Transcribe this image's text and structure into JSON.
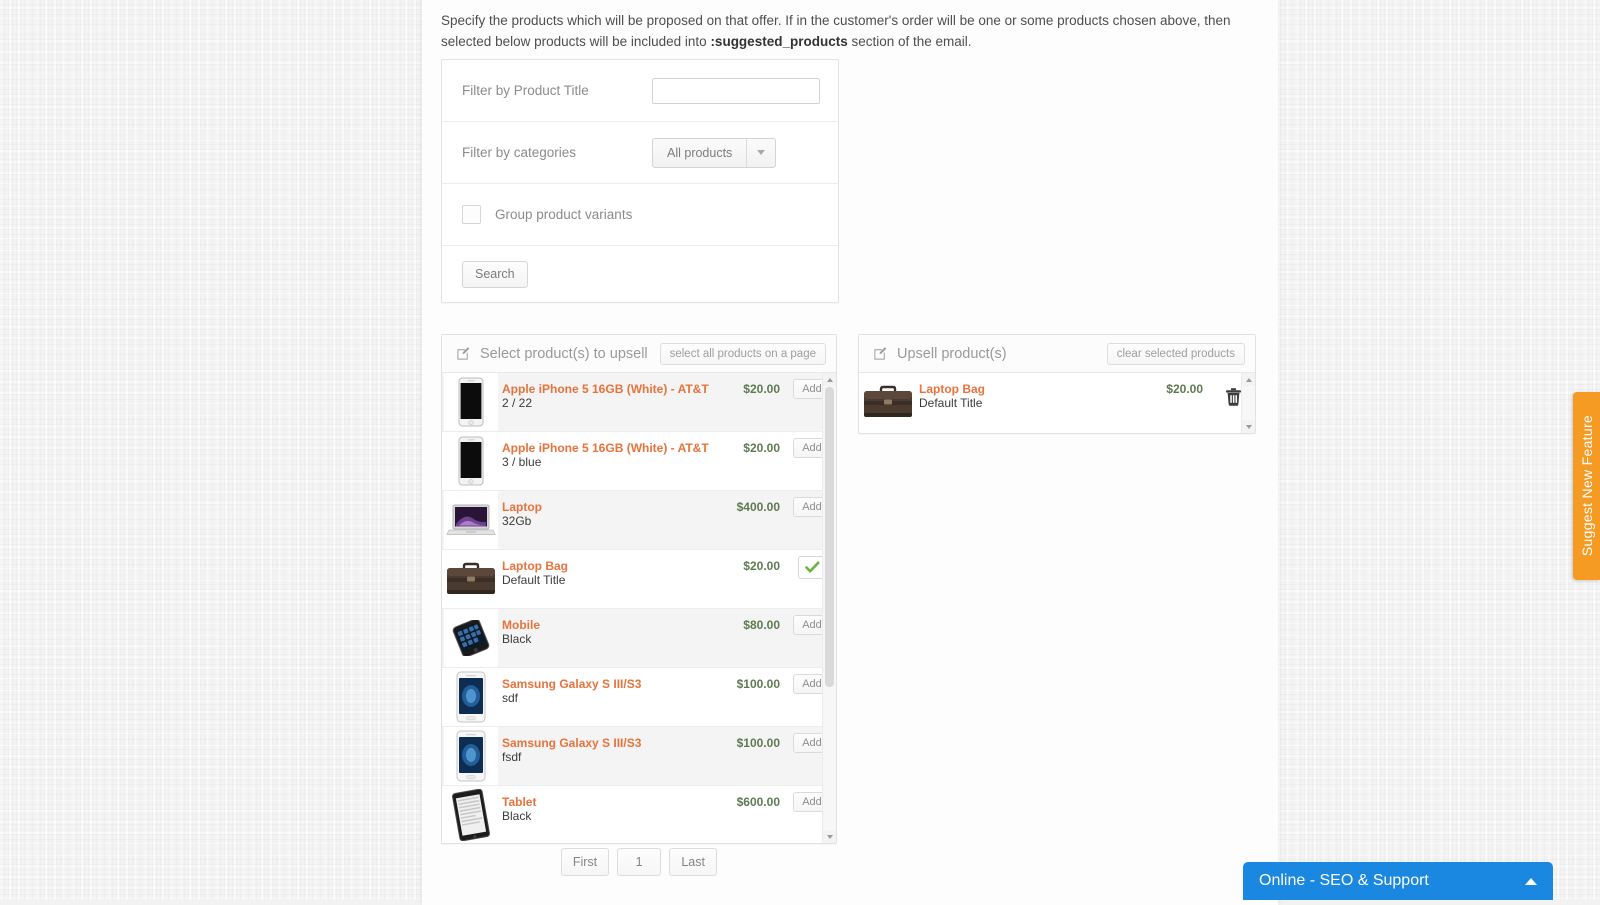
{
  "intro": {
    "line1": "Specify the products which will be proposed on that offer. If in the customer's order will be one or some products chosen above, then selected",
    "line2_pre": "below products will be included into ",
    "line2_bold": ":suggested_products",
    "line2_post": " section of the email."
  },
  "filters": {
    "title_label": "Filter by Product Title",
    "title_value": "",
    "title_placeholder": "",
    "categories_label": "Filter by categories",
    "categories_selected": "All products",
    "group_variants_label": "Group product variants",
    "group_variants_checked": false,
    "search_label": "Search"
  },
  "left_panel": {
    "title": "Select product(s) to upsell",
    "action_label": "select all products on a page",
    "icon": "edit-square-icon",
    "rows": [
      {
        "name": "Apple iPhone 5 16GB (White) - AT&T",
        "variant": "2 / 22",
        "price": "$20.00",
        "action": "Add",
        "added": false,
        "thumb": "iphone-white",
        "alt": true
      },
      {
        "name": "Apple iPhone 5 16GB (White) - AT&T",
        "variant": "3 / blue",
        "price": "$20.00",
        "action": "Add",
        "added": false,
        "thumb": "iphone-white",
        "alt": false
      },
      {
        "name": "Laptop",
        "variant": "32Gb",
        "price": "$400.00",
        "action": "Add",
        "added": false,
        "thumb": "laptop",
        "alt": true
      },
      {
        "name": "Laptop Bag",
        "variant": "Default Title",
        "price": "$20.00",
        "action": "",
        "added": true,
        "thumb": "bag",
        "alt": false
      },
      {
        "name": "Mobile",
        "variant": "Black",
        "price": "$80.00",
        "action": "Add",
        "added": false,
        "thumb": "mobile-dark",
        "alt": true
      },
      {
        "name": "Samsung Galaxy S III/S3",
        "variant": "sdf",
        "price": "$100.00",
        "action": "Add",
        "added": false,
        "thumb": "galaxy",
        "alt": false
      },
      {
        "name": "Samsung Galaxy S III/S3",
        "variant": "fsdf",
        "price": "$100.00",
        "action": "Add",
        "added": false,
        "thumb": "galaxy",
        "alt": true
      },
      {
        "name": "Tablet",
        "variant": "Black",
        "price": "$600.00",
        "action": "Add",
        "added": false,
        "thumb": "tablet",
        "alt": false
      }
    ]
  },
  "right_panel": {
    "title": "Upsell product(s)",
    "action_label": "clear selected products",
    "icon": "edit-square-icon",
    "rows": [
      {
        "name": "Laptop Bag",
        "variant": "Default Title",
        "price": "$20.00",
        "thumb": "bag",
        "delete_icon": "trash-icon"
      }
    ]
  },
  "pagination": {
    "first": "First",
    "current": "1",
    "last": "Last"
  },
  "suggest_tab": {
    "label": "Suggest New Feature"
  },
  "chat": {
    "label": "Online - SEO & Support",
    "chevron": "chevron-up-icon"
  },
  "colors": {
    "accent_orange": "#e8733c",
    "price_green": "#5f7a52",
    "tab_orange": "#f59a23",
    "chat_blue": "#1a87e0"
  }
}
